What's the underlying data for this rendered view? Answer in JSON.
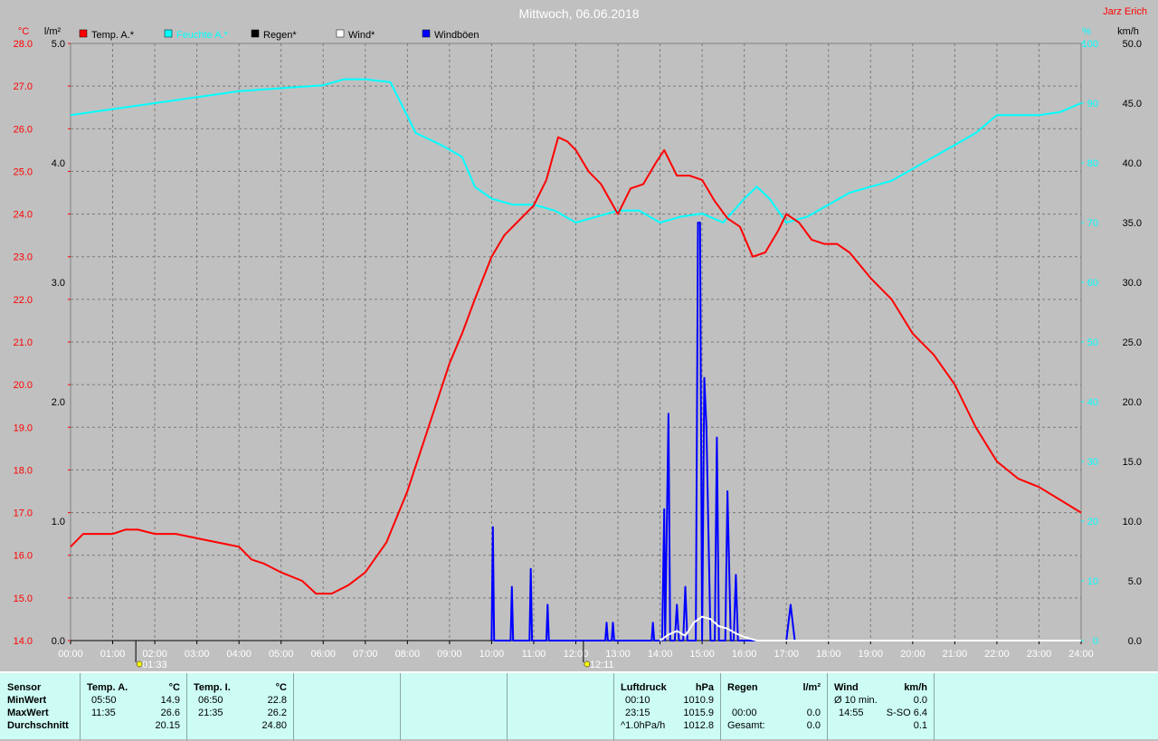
{
  "title": "Mittwoch, 06.06.2018",
  "author": "Jarz Erich",
  "axes": {
    "left_temp_unit": "°C",
    "left_rain_unit": "l/m²",
    "right_pct_unit": "%",
    "right_wind_unit": "km/h",
    "temp_ticks": [
      "28.0",
      "27.0",
      "26.0",
      "25.0",
      "24.0",
      "23.0",
      "22.0",
      "21.0",
      "20.0",
      "19.0",
      "18.0",
      "17.0",
      "16.0",
      "15.0",
      "14.0"
    ],
    "rain_ticks": [
      "5.0",
      "4.0",
      "3.0",
      "2.0",
      "1.0",
      "0.0"
    ],
    "pct_ticks": [
      "100",
      "90",
      "80",
      "70",
      "60",
      "50",
      "40",
      "30",
      "20",
      "10",
      "0"
    ],
    "wind_ticks": [
      "50.0",
      "45.0",
      "40.0",
      "35.0",
      "30.0",
      "25.0",
      "20.0",
      "15.0",
      "10.0",
      "5.0",
      "0.0"
    ],
    "time_ticks": [
      "00:00",
      "01:00",
      "02:00",
      "03:00",
      "04:00",
      "05:00",
      "06:00",
      "07:00",
      "08:00",
      "09:00",
      "10:00",
      "11:00",
      "12:00",
      "13:00",
      "14:00",
      "15:00",
      "16:00",
      "17:00",
      "18:00",
      "19:00",
      "20:00",
      "21:00",
      "22:00",
      "23:00",
      "24:00"
    ]
  },
  "legend": [
    {
      "label": "Temp. A.*",
      "color": "#ff0000"
    },
    {
      "label": "Feuchte A.*",
      "color": "#00ffff"
    },
    {
      "label": "Regen*",
      "color": "#000000"
    },
    {
      "label": "Wind*",
      "color": "#ffffff"
    },
    {
      "label": "Windböen",
      "color": "#0000ff"
    }
  ],
  "sun_markers": [
    {
      "label": "01:33",
      "hour": 1.55
    },
    {
      "label": "12:11",
      "hour": 12.18
    }
  ],
  "chart_data": {
    "type": "line",
    "title": "Mittwoch, 06.06.2018",
    "x_unit": "hour of day",
    "xlim": [
      0,
      24
    ],
    "series": [
      {
        "name": "Temp. A.*",
        "axis": "°C",
        "ylim": [
          14,
          28
        ],
        "color": "#ff0000",
        "points": [
          [
            0,
            16.2
          ],
          [
            0.3,
            16.5
          ],
          [
            0.7,
            16.5
          ],
          [
            1,
            16.5
          ],
          [
            1.3,
            16.6
          ],
          [
            1.6,
            16.6
          ],
          [
            2,
            16.5
          ],
          [
            2.5,
            16.5
          ],
          [
            3,
            16.4
          ],
          [
            3.5,
            16.3
          ],
          [
            4,
            16.2
          ],
          [
            4.3,
            15.9
          ],
          [
            4.6,
            15.8
          ],
          [
            5,
            15.6
          ],
          [
            5.5,
            15.4
          ],
          [
            5.83,
            15.1
          ],
          [
            6.2,
            15.1
          ],
          [
            6.6,
            15.3
          ],
          [
            7,
            15.6
          ],
          [
            7.5,
            16.3
          ],
          [
            8,
            17.5
          ],
          [
            8.5,
            19.0
          ],
          [
            9,
            20.5
          ],
          [
            9.3,
            21.2
          ],
          [
            9.6,
            22.0
          ],
          [
            10,
            23.0
          ],
          [
            10.3,
            23.5
          ],
          [
            10.6,
            23.8
          ],
          [
            11,
            24.2
          ],
          [
            11.3,
            24.8
          ],
          [
            11.58,
            25.8
          ],
          [
            11.8,
            25.7
          ],
          [
            12,
            25.5
          ],
          [
            12.3,
            25.0
          ],
          [
            12.6,
            24.7
          ],
          [
            13,
            24.0
          ],
          [
            13.3,
            24.6
          ],
          [
            13.6,
            24.7
          ],
          [
            13.9,
            25.2
          ],
          [
            14.1,
            25.5
          ],
          [
            14.4,
            24.9
          ],
          [
            14.7,
            24.9
          ],
          [
            15,
            24.8
          ],
          [
            15.3,
            24.3
          ],
          [
            15.6,
            23.9
          ],
          [
            15.9,
            23.7
          ],
          [
            16.2,
            23.0
          ],
          [
            16.5,
            23.1
          ],
          [
            16.8,
            23.6
          ],
          [
            17,
            24.0
          ],
          [
            17.3,
            23.8
          ],
          [
            17.6,
            23.4
          ],
          [
            17.9,
            23.3
          ],
          [
            18.2,
            23.3
          ],
          [
            18.5,
            23.1
          ],
          [
            19,
            22.5
          ],
          [
            19.5,
            22.0
          ],
          [
            20,
            21.2
          ],
          [
            20.5,
            20.7
          ],
          [
            21,
            20.0
          ],
          [
            21.5,
            19.0
          ],
          [
            22,
            18.2
          ],
          [
            22.5,
            17.8
          ],
          [
            23,
            17.6
          ],
          [
            23.5,
            17.3
          ],
          [
            24,
            17.0
          ]
        ]
      },
      {
        "name": "Feuchte A.*",
        "axis": "%",
        "ylim": [
          0,
          100
        ],
        "color": "#00ffff",
        "points": [
          [
            0,
            88
          ],
          [
            1,
            89
          ],
          [
            2,
            90
          ],
          [
            3,
            91
          ],
          [
            4,
            92
          ],
          [
            5,
            92.5
          ],
          [
            6,
            93
          ],
          [
            6.5,
            94
          ],
          [
            7,
            94
          ],
          [
            7.6,
            93.5
          ],
          [
            8.2,
            85
          ],
          [
            8.8,
            83
          ],
          [
            9.3,
            81
          ],
          [
            9.6,
            76
          ],
          [
            10,
            74
          ],
          [
            10.5,
            73
          ],
          [
            11,
            73
          ],
          [
            11.5,
            72
          ],
          [
            12,
            70
          ],
          [
            12.5,
            71
          ],
          [
            13,
            72
          ],
          [
            13.5,
            72
          ],
          [
            14,
            70
          ],
          [
            14.5,
            71
          ],
          [
            15,
            71.5
          ],
          [
            15.5,
            70
          ],
          [
            16,
            74
          ],
          [
            16.3,
            76
          ],
          [
            16.6,
            74
          ],
          [
            17,
            70
          ],
          [
            17.5,
            71
          ],
          [
            18,
            73
          ],
          [
            18.5,
            75
          ],
          [
            19,
            76
          ],
          [
            19.5,
            77
          ],
          [
            20,
            79
          ],
          [
            20.5,
            81
          ],
          [
            21,
            83
          ],
          [
            21.5,
            85
          ],
          [
            22,
            88
          ],
          [
            22.5,
            88
          ],
          [
            23,
            88
          ],
          [
            23.5,
            88.5
          ],
          [
            24,
            90
          ]
        ]
      },
      {
        "name": "Regen*",
        "axis": "l/m²",
        "ylim": [
          0,
          5
        ],
        "color": "#000000",
        "points": [
          [
            0,
            0
          ],
          [
            24,
            0
          ]
        ]
      },
      {
        "name": "Wind*",
        "axis": "km/h",
        "ylim": [
          0,
          50
        ],
        "color": "#ffffff",
        "points": [
          [
            14,
            0
          ],
          [
            14.2,
            0.5
          ],
          [
            14.4,
            0.8
          ],
          [
            14.6,
            0.4
          ],
          [
            14.8,
            1.5
          ],
          [
            15,
            2.0
          ],
          [
            15.2,
            1.8
          ],
          [
            15.4,
            1.2
          ],
          [
            15.6,
            1.0
          ],
          [
            15.8,
            0.6
          ],
          [
            16,
            0.3
          ],
          [
            16.3,
            0
          ],
          [
            24,
            0
          ]
        ]
      },
      {
        "name": "Windböen",
        "axis": "km/h",
        "ylim": [
          0,
          50
        ],
        "color": "#0000ff",
        "points": [
          [
            10,
            0
          ],
          [
            10.03,
            9.5
          ],
          [
            10.06,
            0
          ],
          [
            10.45,
            0
          ],
          [
            10.48,
            4.5
          ],
          [
            10.51,
            0
          ],
          [
            10.9,
            0
          ],
          [
            10.93,
            6
          ],
          [
            10.96,
            0
          ],
          [
            11.3,
            0
          ],
          [
            11.33,
            3
          ],
          [
            11.36,
            0
          ],
          [
            12.7,
            0
          ],
          [
            12.73,
            1.5
          ],
          [
            12.76,
            0
          ],
          [
            12.85,
            0
          ],
          [
            12.88,
            1.5
          ],
          [
            12.91,
            0
          ],
          [
            13.8,
            0
          ],
          [
            13.83,
            1.5
          ],
          [
            13.86,
            0
          ],
          [
            14.05,
            0
          ],
          [
            14.1,
            11
          ],
          [
            14.12,
            0
          ],
          [
            14.2,
            19
          ],
          [
            14.24,
            0
          ],
          [
            14.35,
            0
          ],
          [
            14.4,
            3
          ],
          [
            14.45,
            0
          ],
          [
            14.55,
            0
          ],
          [
            14.6,
            4.5
          ],
          [
            14.65,
            0
          ],
          [
            14.85,
            0
          ],
          [
            14.9,
            35
          ],
          [
            14.95,
            35
          ],
          [
            15,
            0
          ],
          [
            15.05,
            22
          ],
          [
            15.1,
            18
          ],
          [
            15.2,
            0
          ],
          [
            15.3,
            0
          ],
          [
            15.35,
            17
          ],
          [
            15.4,
            0
          ],
          [
            15.55,
            0
          ],
          [
            15.6,
            12.5
          ],
          [
            15.68,
            0
          ],
          [
            15.75,
            0
          ],
          [
            15.8,
            5.5
          ],
          [
            15.85,
            0
          ],
          [
            16.3,
            0
          ],
          [
            16.35,
            0
          ],
          [
            17,
            0
          ],
          [
            17.1,
            3
          ],
          [
            17.2,
            0
          ],
          [
            24,
            0
          ]
        ]
      }
    ]
  },
  "stats": {
    "sensor": {
      "header": "Sensor",
      "min": "MinWert",
      "max": "MaxWert",
      "avg": "Durchschnitt"
    },
    "temp_a": {
      "header": "Temp. A.",
      "unit": "°C",
      "min_time": "05:50",
      "min_val": "14.9",
      "max_time": "11:35",
      "max_val": "26.6",
      "avg": "20.15"
    },
    "temp_i": {
      "header": "Temp. I.",
      "unit": "°C",
      "min_time": "06:50",
      "min_val": "22.8",
      "max_time": "21:35",
      "max_val": "26.2",
      "avg": "24.80"
    },
    "pressure": {
      "header": "Luftdruck",
      "unit": "hPa",
      "min_time": "00:10",
      "min_val": "1010.9",
      "max_time": "23:15",
      "max_val": "1015.9",
      "trend_label": "^1.0hPa/h",
      "avg": "1012.8"
    },
    "rain": {
      "header": "Regen",
      "unit": "l/m²",
      "max_time": "00:00",
      "max_val": "0.0",
      "total_label": "Gesamt:",
      "total": "0.0"
    },
    "wind": {
      "header": "Wind",
      "unit": "km/h",
      "avg10_label": "Ø 10 min.",
      "avg10": "0.0",
      "max_time": "14:55",
      "max_val": "S-SO 6.4",
      "avg": "0.1"
    }
  }
}
